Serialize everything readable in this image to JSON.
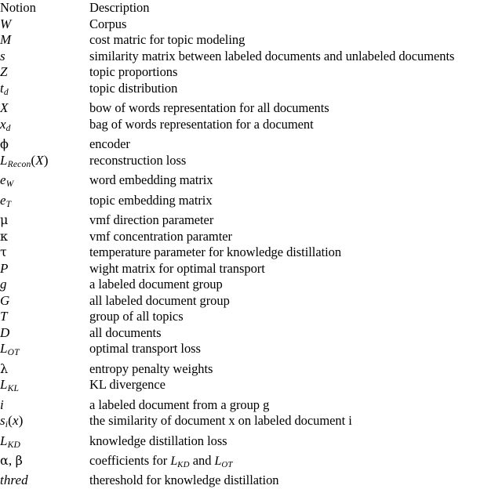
{
  "table": {
    "headers": {
      "notion": "Notion",
      "description": "Description"
    },
    "rows": [
      {
        "notion": "W",
        "description": "Corpus"
      },
      {
        "notion": "M",
        "description": "cost matric for topic modeling"
      },
      {
        "notion": "s",
        "description": "similarity matrix between labeled documents and unlabeled documents"
      },
      {
        "notion": "Z",
        "description": "topic proportions"
      },
      {
        "notion": "t_d",
        "description": "topic distribution"
      },
      {
        "notion": "X",
        "description": "bow of words representation for all documents"
      },
      {
        "notion": "x_d",
        "description": "bag of words representation for a document"
      },
      {
        "notion": "phi",
        "description": "encoder"
      },
      {
        "notion": "L_Recon(X)",
        "description": "reconstruction loss"
      },
      {
        "notion": "e_W",
        "description": "word embedding matrix"
      },
      {
        "notion": "e_T",
        "description": "topic embedding matrix"
      },
      {
        "notion": "mu",
        "description": "vmf direction parameter"
      },
      {
        "notion": "kappa",
        "description": "vmf concentration paramter"
      },
      {
        "notion": "tau",
        "description": "temperature parameter for knowledge distillation"
      },
      {
        "notion": "P",
        "description": "wight matrix for optimal transport"
      },
      {
        "notion": "g",
        "description": "a labeled document group"
      },
      {
        "notion": "G",
        "description": "all labeled document group"
      },
      {
        "notion": "T",
        "description": "group of all topics"
      },
      {
        "notion": "D",
        "description": "all documents"
      },
      {
        "notion": "L_OT",
        "description": "optimal transport loss"
      },
      {
        "notion": "lambda",
        "description": "entropy penalty weights"
      },
      {
        "notion": "L_KL",
        "description": "KL divergence"
      },
      {
        "notion": "i",
        "description": "a labeled document from a group g"
      },
      {
        "notion": "s_i(x)",
        "description": "the similarity of document x on labeled document i"
      },
      {
        "notion": "L_KD",
        "description": "knowledge distillation loss"
      },
      {
        "notion": "alpha,beta",
        "description_pre": "coefficients for ",
        "description_math1": "L_KD",
        "description_mid": " and ",
        "description_math2": "L_OT"
      },
      {
        "notion": "thred",
        "description": "thereshold for knowledge distillation"
      }
    ]
  },
  "symbols": {
    "W": "W",
    "M": "M",
    "s": "s",
    "Z": "Z",
    "X": "X",
    "P": "P",
    "g": "g",
    "G": "G",
    "T": "T",
    "D": "D",
    "i": "i",
    "L": "L",
    "e": "e",
    "t": "t",
    "x": "x",
    "d": "d",
    "phi": "ϕ",
    "mu": "μ",
    "kappa": "κ",
    "tau": "τ",
    "lambda": "λ",
    "alpha": "α",
    "beta": "β",
    "Recon": "Recon",
    "OT": "OT",
    "KL": "KL",
    "KD": "KD",
    "W_sub": "W",
    "T_sub": "T",
    "thred": "thred",
    "lparen": "(",
    "rparen": ")",
    "comma": ","
  },
  "style": {
    "background": "#ffffff",
    "text_color": "#000000"
  }
}
